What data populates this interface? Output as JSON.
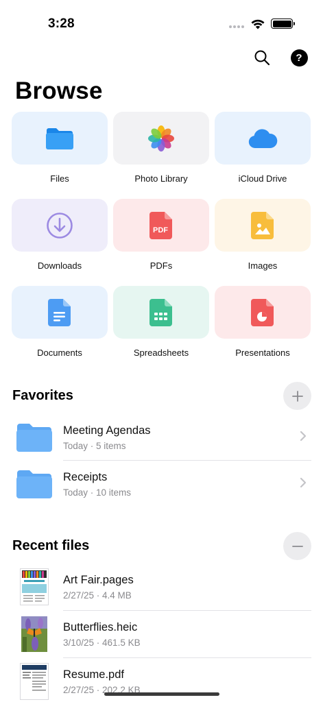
{
  "status_bar": {
    "time": "3:28"
  },
  "header": {
    "title": "Browse"
  },
  "categories": [
    {
      "label": "Files",
      "icon": "folder-icon",
      "bg": "#e8f2fd"
    },
    {
      "label": "Photo Library",
      "icon": "photos-icon",
      "bg": "#f2f2f4"
    },
    {
      "label": "iCloud Drive",
      "icon": "cloud-icon",
      "bg": "#e8f2fd"
    },
    {
      "label": "Downloads",
      "icon": "download-icon",
      "bg": "#efedfa"
    },
    {
      "label": "PDFs",
      "icon": "pdf-icon",
      "bg": "#fde9ea"
    },
    {
      "label": "Images",
      "icon": "image-icon",
      "bg": "#fef5e6"
    },
    {
      "label": "Documents",
      "icon": "document-icon",
      "bg": "#e8f2fd"
    },
    {
      "label": "Spreadsheets",
      "icon": "spreadsheet-icon",
      "bg": "#e6f6f1"
    },
    {
      "label": "Presentations",
      "icon": "presentation-icon",
      "bg": "#fde9ea"
    }
  ],
  "pdf_badge": "PDF",
  "favorites": {
    "title": "Favorites",
    "items": [
      {
        "title": "Meeting Agendas",
        "subtitle": "Today · 5 items"
      },
      {
        "title": "Receipts",
        "subtitle": "Today · 10 items"
      }
    ]
  },
  "recent": {
    "title": "Recent files",
    "items": [
      {
        "title": "Art Fair.pages",
        "subtitle": "2/27/25 · 4.4 MB"
      },
      {
        "title": "Butterflies.heic",
        "subtitle": "3/10/25 · 461.5 KB"
      },
      {
        "title": "Resume.pdf",
        "subtitle": "2/27/25 · 202.2 KB"
      }
    ]
  },
  "colors": {
    "accent_blue": "#3b9cf3",
    "folder_blue": "#6db3f8"
  }
}
